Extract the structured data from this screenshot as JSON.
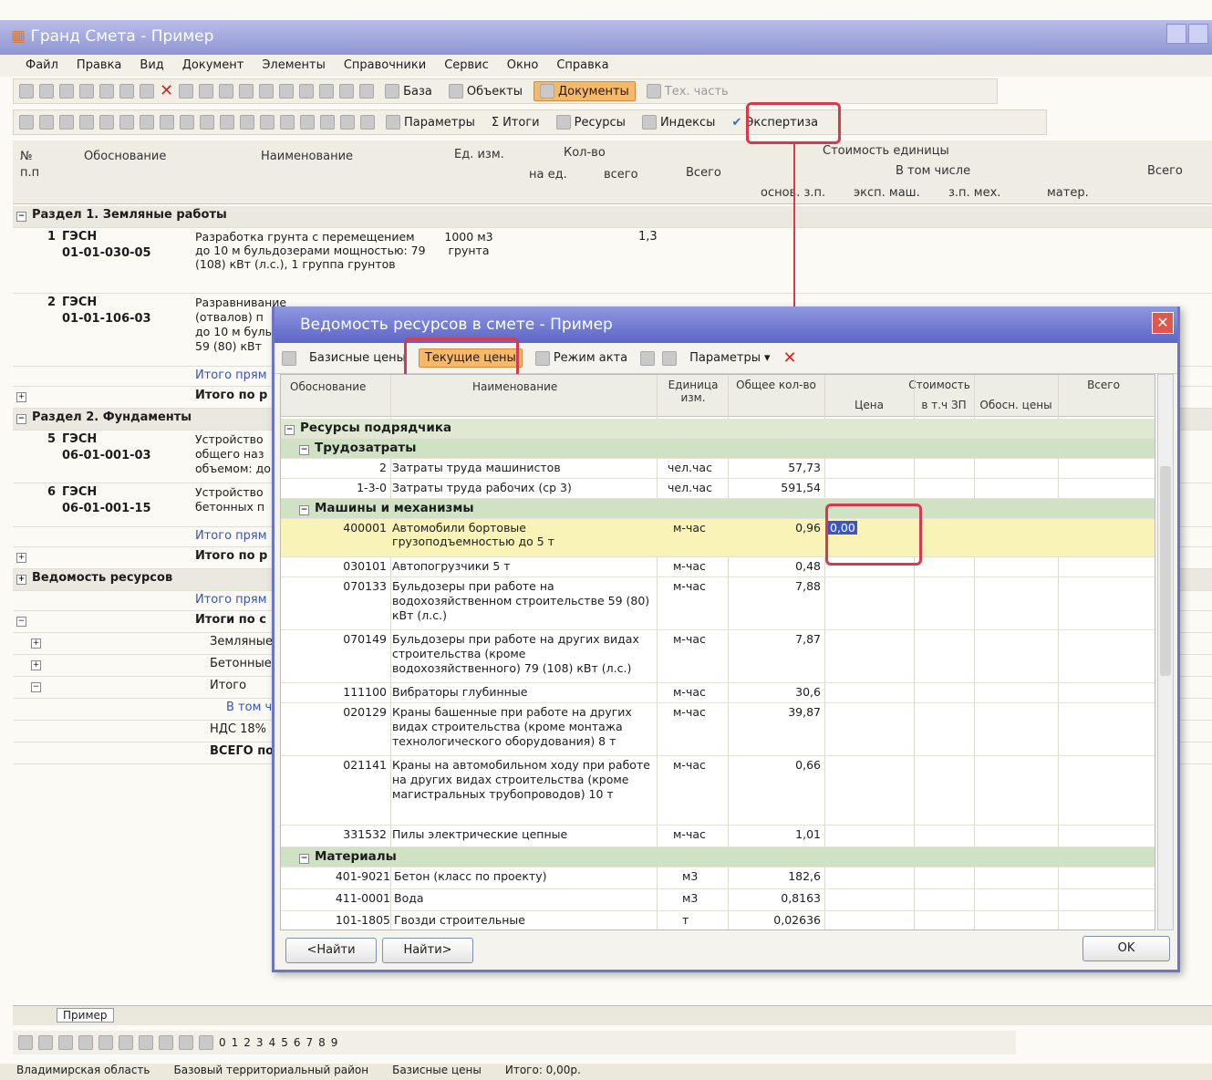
{
  "window": {
    "title": "Гранд Смета - Пример"
  },
  "menu": [
    "Файл",
    "Правка",
    "Вид",
    "Документ",
    "Элементы",
    "Справочники",
    "Сервис",
    "Окно",
    "Справка"
  ],
  "toolbar1": {
    "base": "База",
    "objects": "Объекты",
    "documents": "Документы",
    "tech": "Тех. часть"
  },
  "toolbar2": {
    "params": "Параметры",
    "totals": "Итоги",
    "resources": "Ресурсы",
    "indexes": "Индексы",
    "expertise": "Экспертиза"
  },
  "header": {
    "num": "№",
    "pp": "п.п",
    "basis": "Обоснование",
    "name": "Наименование",
    "unit": "Ед. изм.",
    "qty": "Кол-во",
    "per_unit": "на ед.",
    "total_qty": "всего",
    "unit_cost": "Стоимость единицы",
    "total": "Всего",
    "incl": "В том числе",
    "base_wage": "основ. з.п.",
    "mach": "эксп. маш.",
    "mech_wage": "з.п. мех.",
    "mat": "матер.",
    "total2": "Всего"
  },
  "main": {
    "sec1": "Раздел 1. Земляные работы",
    "r1": {
      "n": "1",
      "code1": "ГЭСН",
      "code2": "01-01-030-05",
      "name": "Разработка грунта с перемещением до 10 м бульдозерами мощностью: 79 (108) кВт (л.с.), 1 группа грунтов",
      "unit": "1000 м3 грунта",
      "qty": "1,3"
    },
    "r2": {
      "n": "2",
      "code1": "ГЭСН",
      "code2": "01-01-106-03",
      "name": "Разравнивание",
      "name2": "(отвалов) п",
      "name3": "до 10 м бульд",
      "name4": "59 (80) кВт"
    },
    "direct1": "Итого прям",
    "total1": "Итого по р",
    "sec2": "Раздел 2. Фундаменты",
    "r5": {
      "n": "5",
      "code1": "ГЭСН",
      "code2": "06-01-001-03",
      "name": "Устройство",
      "name2": "общего наз",
      "name3": "объемом: до"
    },
    "r6": {
      "n": "6",
      "code1": "ГЭСН",
      "code2": "06-01-001-15",
      "name": "Устройство",
      "name2": "бетонных п"
    },
    "direct2": "Итого прям",
    "total2": "Итого по р",
    "res": "Ведомость ресурсов",
    "direct3": "Итого прям",
    "totals": "Итоги по с",
    "earth": "Земляные",
    "concrete": "Бетонные",
    "itogo": "Итого",
    "incl": "В том ч",
    "vat": "НДС 18%",
    "grand": "ВСЕГО по"
  },
  "sheet_tab": "Пример",
  "bottom_nums": [
    "0",
    "1",
    "2",
    "3",
    "4",
    "5",
    "6",
    "7",
    "8",
    "9"
  ],
  "status": [
    "Владимирская область",
    "Базовый территориальный район",
    "Базисные цены",
    "Итого: 0,00р."
  ],
  "dialog": {
    "title": "Ведомость ресурсов в смете - Пример",
    "base_prices": "Базисные цены",
    "current_prices": "Текущие цены",
    "act_mode": "Режим акта",
    "params": "Параметры",
    "h_basis": "Обоснование",
    "h_name": "Наименование",
    "h_unit": "Единица изм.",
    "h_qty": "Общее кол-во",
    "h_cost": "Стоимость",
    "h_price": "Цена",
    "h_wage": "в т.ч ЗП",
    "h_just": "Обосн. цены",
    "h_total": "Всего",
    "sec_contractor": "Ресурсы подрядчика",
    "sec_labor": "Трудозатраты",
    "sec_machines": "Машины и механизмы",
    "sec_materials": "Материалы",
    "labor": [
      {
        "code": "2",
        "name": "Затраты труда машинистов",
        "unit": "чел.час",
        "qty": "57,73"
      },
      {
        "code": "1-3-0",
        "name": "Затраты труда рабочих (ср 3)",
        "unit": "чел.час",
        "qty": "591,54"
      }
    ],
    "machines": [
      {
        "code": "400001",
        "name": "Автомобили бортовые грузоподъемностью до 5 т",
        "unit": "м-час",
        "qty": "0,96",
        "price": "0,00"
      },
      {
        "code": "030101",
        "name": "Автопогрузчики 5 т",
        "unit": "м-час",
        "qty": "0,48"
      },
      {
        "code": "070133",
        "name": "Бульдозеры при работе на водохозяйственном строительстве 59 (80) кВт (л.с.)",
        "unit": "м-час",
        "qty": "7,88"
      },
      {
        "code": "070149",
        "name": "Бульдозеры при работе на других видах строительства (кроме водохозяйственного) 79 (108) кВт (л.с.)",
        "unit": "м-час",
        "qty": "7,87"
      },
      {
        "code": "111100",
        "name": "Вибраторы глубинные",
        "unit": "м-час",
        "qty": "30,6"
      },
      {
        "code": "020129",
        "name": "Краны башенные при работе на других видах строительства (кроме монтажа технологического оборудования) 8 т",
        "unit": "м-час",
        "qty": "39,87"
      },
      {
        "code": "021141",
        "name": "Краны на автомобильном ходу при работе на других видах строительства (кроме магистральных трубопроводов) 10 т",
        "unit": "м-час",
        "qty": "0,66"
      },
      {
        "code": "331532",
        "name": "Пилы электрические цепные",
        "unit": "м-час",
        "qty": "1,01"
      }
    ],
    "materials": [
      {
        "code": "401-9021",
        "name": "Бетон (класс по проекту)",
        "unit": "м3",
        "qty": "182,6"
      },
      {
        "code": "411-0001",
        "name": "Вода",
        "unit": "м3",
        "qty": "0,8163"
      },
      {
        "code": "101-1805",
        "name": "Гвозди строительные",
        "unit": "т",
        "qty": "0,02636"
      }
    ],
    "find_prev": "<Найти",
    "find_next": "Найти>",
    "ok": "OK"
  }
}
